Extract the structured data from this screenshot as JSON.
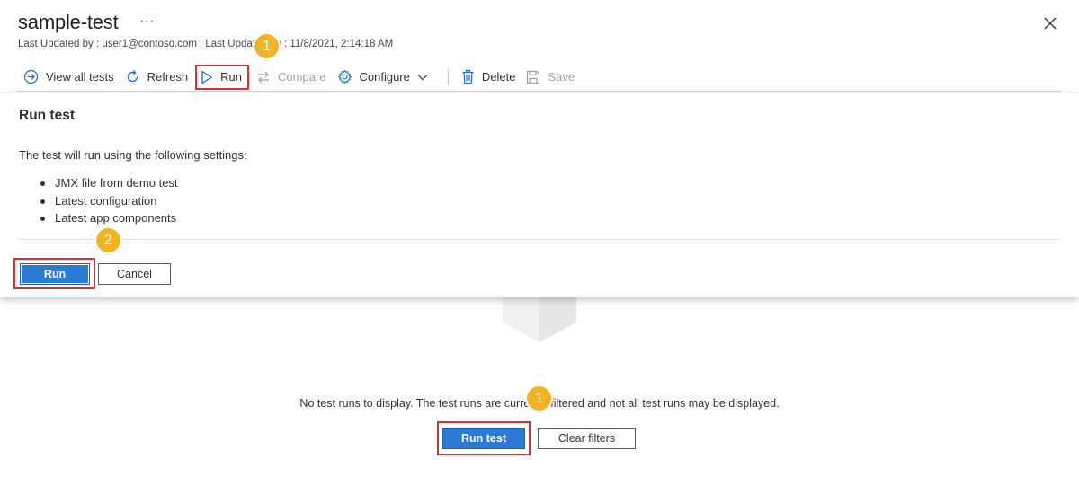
{
  "header": {
    "title": "sample-test",
    "more_label": "···",
    "subtitle": "Last Updated by : user1@contoso.com | Last Updated on : 11/8/2021, 2:14:18 AM"
  },
  "toolbar": {
    "view_all_tests": "View all tests",
    "refresh": "Refresh",
    "run": "Run",
    "compare": "Compare",
    "configure": "Configure",
    "delete": "Delete",
    "save": "Save"
  },
  "dialog": {
    "title": "Run test",
    "description": "The test will run using the following settings:",
    "settings": [
      "JMX file from demo test",
      "Latest configuration",
      "Latest app components"
    ],
    "run_label": "Run",
    "cancel_label": "Cancel"
  },
  "main": {
    "empty_message": "No test runs to display. The test runs are currently filtered and not all test runs may be displayed.",
    "run_test_label": "Run test",
    "clear_filters_label": "Clear filters"
  },
  "callouts": {
    "toolbar_run": "1",
    "dialog_run": "2",
    "main_run": "1"
  },
  "colors": {
    "accent": "#2b7bd4",
    "highlight": "#d13438",
    "callout": "#f0b424"
  },
  "icons": {
    "close": "close-icon",
    "view_all": "arrow-circle-icon",
    "refresh": "refresh-icon",
    "run": "play-icon",
    "compare": "compare-icon",
    "configure": "gear-icon",
    "delete": "trash-icon",
    "save": "save-icon"
  }
}
